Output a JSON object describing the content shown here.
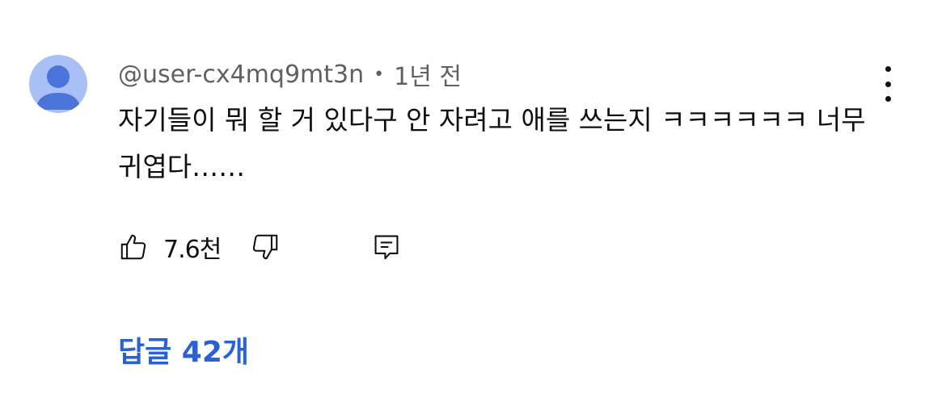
{
  "comment": {
    "author": "@user-cx4mq9mt3n",
    "separator": "•",
    "time": "1년 전",
    "text": "자기들이 뭐 할 거 있다구 안 자려고 애를 쓰는지 ㅋㅋㅋㅋㅋㅋ 너무 귀엽다……",
    "like_count": "7.6천",
    "replies_label": "답글 42개"
  },
  "icons": {
    "avatar": "default-avatar-icon",
    "menu": "more-vert-icon",
    "like": "thumb-up-icon",
    "dislike": "thumb-down-icon",
    "reply": "comment-reply-icon"
  },
  "colors": {
    "avatar_background": "#a8c0f5",
    "avatar_figure": "#4a74d9",
    "meta_text": "#606060",
    "replies_link": "#2a62d5"
  }
}
